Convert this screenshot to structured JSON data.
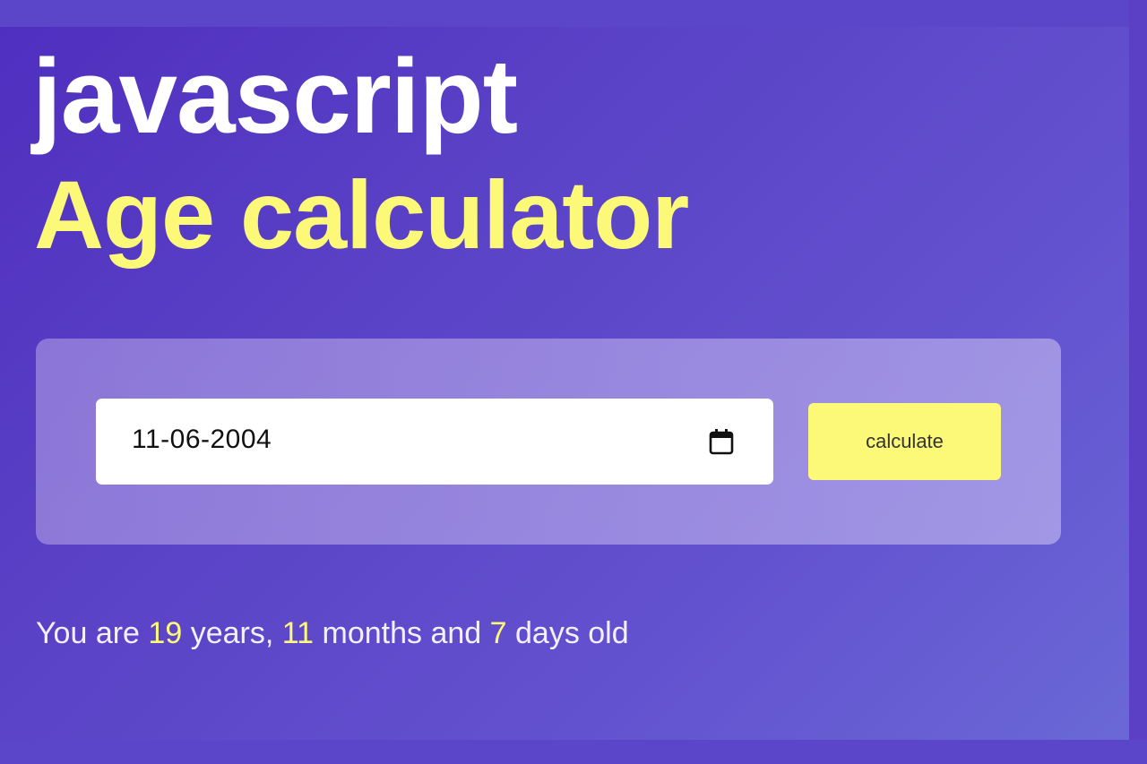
{
  "title": {
    "line1": "javascript",
    "line2": "Age calculator"
  },
  "form": {
    "date_value": "11-06-2004",
    "calendar_icon": "calendar-icon",
    "button_label": "calculate"
  },
  "result": {
    "prefix": "You are",
    "years": "19",
    "years_label": "years,",
    "months": "11",
    "months_label": "months and",
    "days": "7",
    "days_label": "days old"
  },
  "colors": {
    "background": "#5b45c8",
    "accent_yellow": "#fcf978",
    "title_white": "#ffffff"
  }
}
